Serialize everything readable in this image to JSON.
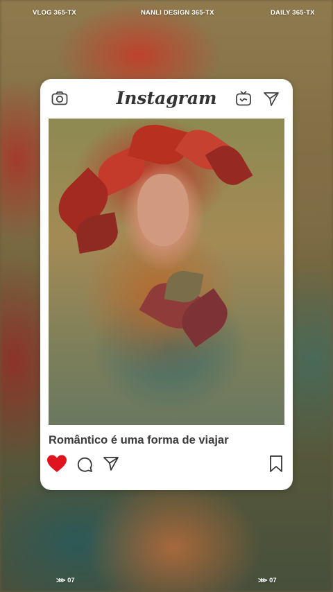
{
  "top_labels": {
    "left": "VLOG 365-TX",
    "center": "NANLI DESIGN 365-TX",
    "right": "DAILY 365-TX"
  },
  "bottom_labels": {
    "left": "⋙ 07",
    "right": "⋙ 07"
  },
  "post": {
    "app_name": "Instagram",
    "caption": "Romântico é uma forma de viajar",
    "liked": true,
    "like_color": "#e0141e"
  },
  "icons": {
    "camera": "camera-icon",
    "tv": "igtv-icon",
    "send": "send-icon",
    "heart": "heart-icon",
    "comment": "comment-icon",
    "share": "share-icon",
    "bookmark": "bookmark-icon"
  }
}
